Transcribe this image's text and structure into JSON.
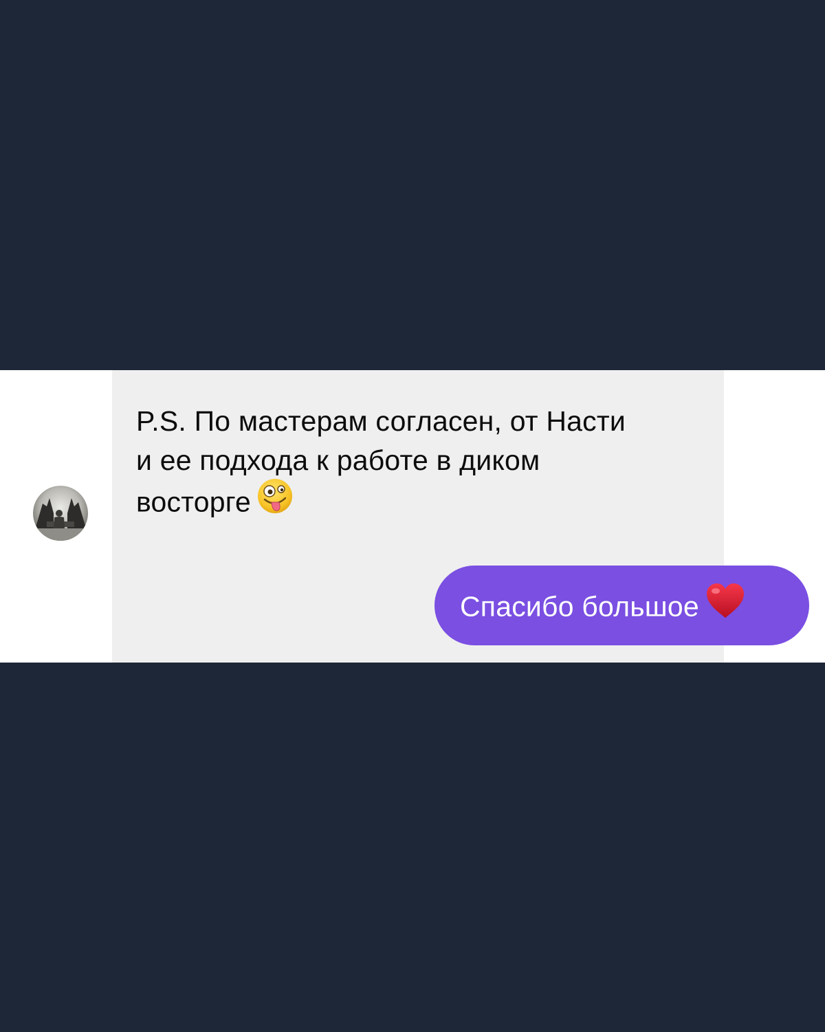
{
  "colors": {
    "page_background": "#1e2737",
    "chat_background": "#ffffff",
    "incoming_bubble": "#efefef",
    "outgoing_bubble": "#7a4fe2",
    "heart": "#d7192d"
  },
  "conversation": {
    "incoming": {
      "text": "P.S. По мастерам согласен, от Насти и ее подхода к работе в диком восторге",
      "emoji": "zany-face-icon",
      "avatar": "avatar-photo"
    },
    "outgoing": {
      "text": "Спасибо большое",
      "emoji": "red-heart-icon"
    }
  }
}
